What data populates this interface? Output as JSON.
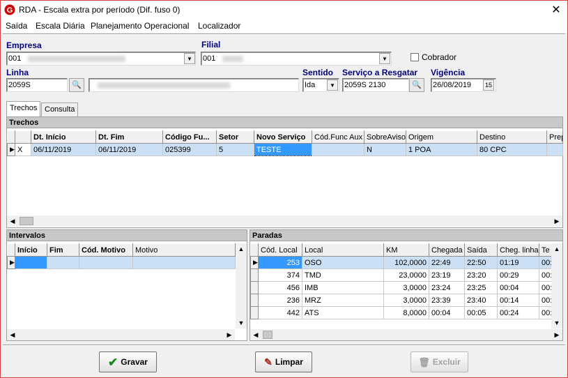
{
  "window": {
    "title": "RDA - Escala extra por período (Dif. fuso 0)",
    "close_glyph": "✕",
    "app_icon": "g-logo-icon",
    "accent": "#cc0000"
  },
  "menu": [
    "Saída",
    "Escala Diária",
    "Planejamento Operacional",
    "Localizador"
  ],
  "form": {
    "empresa_label": "Empresa",
    "empresa_value": "001",
    "filial_label": "Filial",
    "filial_value": "001",
    "cobrador_label": "Cobrador",
    "cobrador_checked": false,
    "linha_label": "Linha",
    "linha_value": "2059S",
    "sentido_label": "Sentido",
    "sentido_value": "Ida",
    "servico_label": "Serviço a Resgatar",
    "servico_value": "2059S 2130",
    "vigencia_label": "Vigência",
    "vigencia_value": "26/08/2019",
    "calendar_glyph": "15"
  },
  "tabs": [
    "Trechos",
    "Consulta"
  ],
  "trechos": {
    "title": "Trechos",
    "columns": [
      "Dt. Início",
      "Dt. Fim",
      "Código Fu...",
      "Setor",
      "Novo Serviço",
      "Cód.Func Aux",
      "SobreAviso",
      "Origem",
      "Destino",
      "Prep"
    ],
    "rows": [
      {
        "mark": "X",
        "dt_inicio": "06/11/2019",
        "dt_fim": "06/11/2019",
        "codigo": "025399",
        "setor": "5",
        "novo_servico": "TESTE",
        "cod_aux": "",
        "sobreaviso": "N",
        "origem": "1 POA",
        "destino": "80 CPC",
        "prep": ""
      }
    ]
  },
  "intervalos": {
    "title": "Intervalos",
    "columns": [
      "Início",
      "Fim",
      "Cód. Motivo",
      "Motivo"
    ]
  },
  "paradas": {
    "title": "Paradas",
    "columns": [
      "Cód. Local",
      "Local",
      "KM",
      "Chegada",
      "Saída",
      "Cheg. linha",
      "Te"
    ],
    "rows": [
      {
        "cod": "253",
        "local": "OSO",
        "km": "102,0000",
        "chegada": "22:49",
        "saida": "22:50",
        "cheg_linha": "01:19",
        "te": "00:"
      },
      {
        "cod": "374",
        "local": "TMD",
        "km": "23,0000",
        "chegada": "23:19",
        "saida": "23:20",
        "cheg_linha": "00:29",
        "te": "00:"
      },
      {
        "cod": "456",
        "local": "IMB",
        "km": "3,0000",
        "chegada": "23:24",
        "saida": "23:25",
        "cheg_linha": "00:04",
        "te": "00:"
      },
      {
        "cod": "236",
        "local": "MRZ",
        "km": "3,0000",
        "chegada": "23:39",
        "saida": "23:40",
        "cheg_linha": "00:14",
        "te": "00:"
      },
      {
        "cod": "442",
        "local": "ATS",
        "km": "8,0000",
        "chegada": "00:04",
        "saida": "00:05",
        "cheg_linha": "00:24",
        "te": "00:"
      }
    ]
  },
  "buttons": {
    "gravar": "Gravar",
    "limpar": "Limpar",
    "excluir": "Excluir"
  }
}
